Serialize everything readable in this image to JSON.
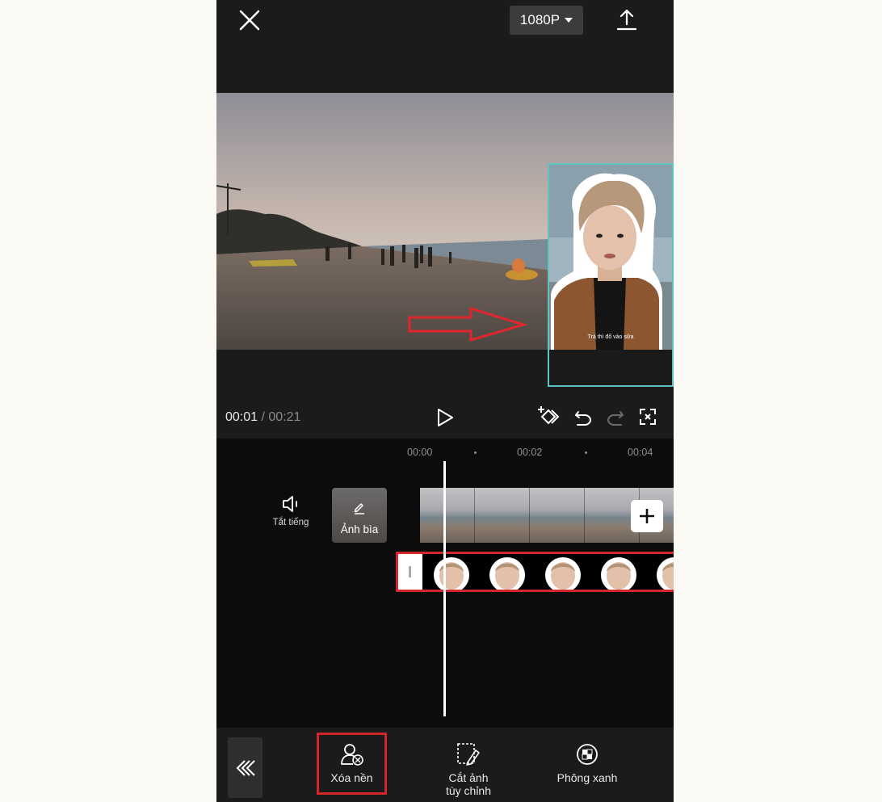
{
  "top_bar": {
    "resolution_label": "1080P",
    "icons": [
      "close-icon",
      "caret-down-icon",
      "export-icon"
    ]
  },
  "preview": {
    "overlay_caption": "Trà thì đổ vào sữa",
    "annotation": "red-arrow-pointing-right",
    "overlay_border_color": "#5fc4bd"
  },
  "controls": {
    "current_time": "00:01",
    "separator": "/",
    "total_time": "00:21",
    "icons": [
      "play-icon",
      "keyframe-icon",
      "undo-icon",
      "redo-icon",
      "fullscreen-icon"
    ]
  },
  "timeline": {
    "ruler": [
      "00:00",
      "00:02",
      "00:04"
    ],
    "mute_label": "Tắt tiếng",
    "cover_label": "Ảnh bìa",
    "add_icon": "plus-icon",
    "highlight_color": "#d4252d"
  },
  "toolbar": {
    "back_icon": "double-chevron-left-icon",
    "items": [
      {
        "label": "Xóa nền",
        "icon": "remove-background-icon",
        "highlighted": true
      },
      {
        "label_line1": "Cắt ảnh",
        "label_line2": "tùy chỉnh",
        "icon": "custom-cutout-icon"
      },
      {
        "label": "Phông xanh",
        "icon": "chroma-key-icon"
      }
    ]
  }
}
